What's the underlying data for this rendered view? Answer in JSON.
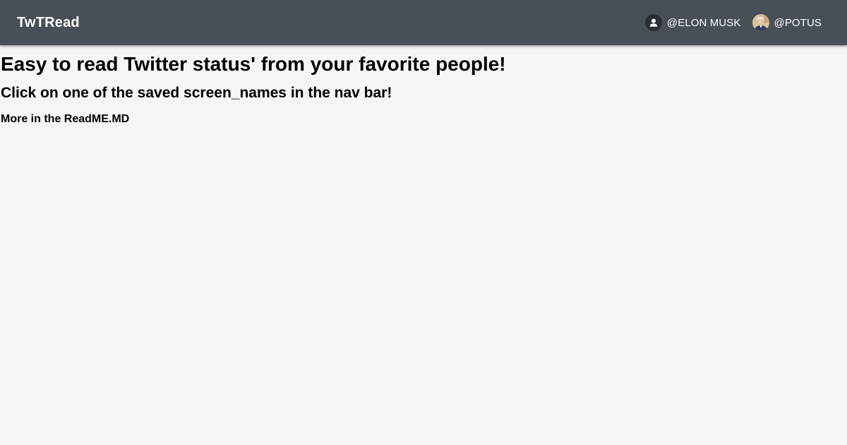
{
  "app": {
    "brand": "TwTRead"
  },
  "nav": {
    "users": [
      {
        "label": "@ELON MUSK",
        "avatar": "generic-person-icon"
      },
      {
        "label": "@POTUS",
        "avatar": "user-photo"
      }
    ]
  },
  "main": {
    "headline": "Easy to read Twitter status' from your favorite people!",
    "subheadline": "Click on one of the saved screen_names in the nav bar!",
    "note": "More in the ReadME.MD"
  },
  "colors": {
    "navbar": "#484f57",
    "background": "#f4f5f7",
    "nav_text": "#ffffff"
  }
}
